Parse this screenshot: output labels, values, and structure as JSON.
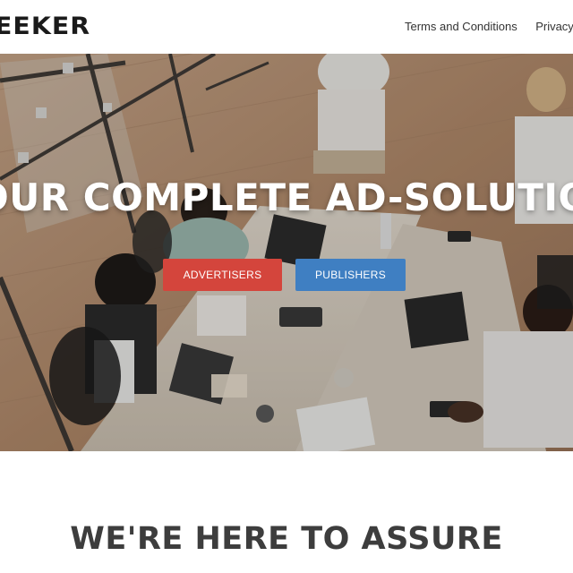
{
  "header": {
    "logo_text": "EEKER",
    "nav": [
      {
        "label": "Terms and Conditions"
      },
      {
        "label": "Privacy S"
      }
    ]
  },
  "hero": {
    "title": "OUR COMPLETE AD-SOLUTIO",
    "buttons": {
      "advertisers": "ADVERTISERS",
      "publishers": "PUBLISHERS"
    }
  },
  "section": {
    "heading": "WE'RE HERE TO ASSURE"
  },
  "colors": {
    "advertisers_button": "#d4453c",
    "publishers_button": "#3f7fc2",
    "logo": "#1a1a1a",
    "heading": "#3d3d3d"
  }
}
